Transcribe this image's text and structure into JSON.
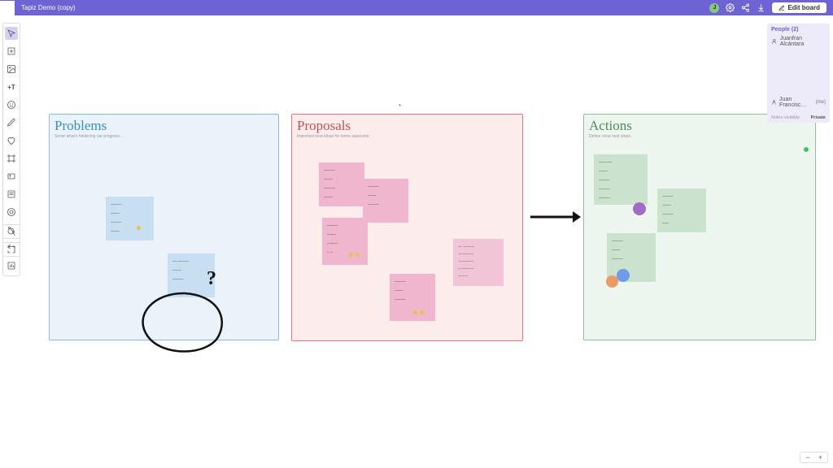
{
  "header": {
    "title": "Tapiz Demo (copy)",
    "avatar_initial": "J",
    "edit_label": "Edit board"
  },
  "people": {
    "heading": "People (2)",
    "user1": "Juanfran Alcántara",
    "user2": "Juan Francisc…",
    "me": "(me)",
    "vis_label": "Notes visibility",
    "vis_value": "Private"
  },
  "frames": {
    "problems": {
      "title": "Problems",
      "sub": "Some what's hindering our progress…"
    },
    "proposals": {
      "title": "Proposals",
      "sub": "Important new ideas for some awesome"
    },
    "actions": {
      "title": "Actions",
      "sub": "Define clear next steps."
    }
  },
  "zoom": {
    "minus": "−",
    "plus": "+"
  },
  "toolbar": {
    "text_label": "+T"
  }
}
